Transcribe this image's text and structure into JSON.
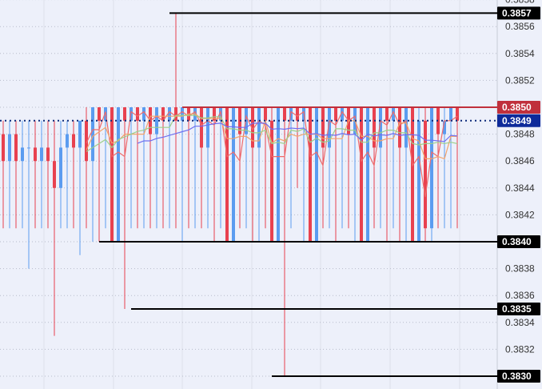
{
  "chart_data": {
    "type": "candlestick",
    "title": "",
    "ylim": [
      0.38295,
      0.38582
    ],
    "y_ticks": [
      "0.3858",
      "0.3856",
      "0.3854",
      "0.3852",
      "0.3850",
      "0.3848",
      "0.3846",
      "0.3844",
      "0.3842",
      "0.3840",
      "0.3838",
      "0.3836",
      "0.3834",
      "0.3832",
      "0.3830"
    ],
    "colors": {
      "up": "#5b9cf0",
      "down": "#e8414f",
      "background": "#edf0fa",
      "grid": "#b8bccb"
    },
    "moving_averages": [
      {
        "period": 3,
        "color": "#ef6a6a"
      },
      {
        "period": 6,
        "color": "#f2a36a"
      },
      {
        "period": 10,
        "color": "#9ccf8a"
      },
      {
        "period": 22,
        "color": "#6f6ff0"
      }
    ],
    "candles": [
      [
        0.3848,
        0.3849,
        0.3841,
        0.3846
      ],
      [
        0.3846,
        0.3849,
        0.3841,
        0.3848
      ],
      [
        0.3848,
        0.3849,
        0.3841,
        0.3846
      ],
      [
        0.3846,
        0.3849,
        0.3841,
        0.3847
      ],
      [
        0.3847,
        0.3849,
        0.3838,
        0.3847
      ],
      [
        0.3847,
        0.3849,
        0.3841,
        0.3846
      ],
      [
        0.3846,
        0.3849,
        0.3841,
        0.3847
      ],
      [
        0.3847,
        0.3849,
        0.3841,
        0.3846
      ],
      [
        0.3846,
        0.3849,
        0.3833,
        0.3844
      ],
      [
        0.3844,
        0.3849,
        0.3841,
        0.3847
      ],
      [
        0.3847,
        0.3849,
        0.3841,
        0.3848
      ],
      [
        0.3848,
        0.3849,
        0.3841,
        0.3847
      ],
      [
        0.3847,
        0.3849,
        0.3839,
        0.3849
      ],
      [
        0.3849,
        0.385,
        0.3841,
        0.3846
      ],
      [
        0.3846,
        0.385,
        0.384,
        0.385
      ],
      [
        0.385,
        0.385,
        0.384,
        0.3849
      ],
      [
        0.3849,
        0.385,
        0.3841,
        0.385
      ],
      [
        0.385,
        0.385,
        0.384,
        0.384
      ],
      [
        0.384,
        0.385,
        0.384,
        0.385
      ],
      [
        0.385,
        0.385,
        0.3835,
        0.3849
      ],
      [
        0.3849,
        0.385,
        0.3841,
        0.385
      ],
      [
        0.385,
        0.385,
        0.3841,
        0.3849
      ],
      [
        0.3849,
        0.385,
        0.3841,
        0.385
      ],
      [
        0.385,
        0.385,
        0.3841,
        0.3848
      ],
      [
        0.3848,
        0.385,
        0.3841,
        0.385
      ],
      [
        0.385,
        0.385,
        0.3841,
        0.3849
      ],
      [
        0.3849,
        0.385,
        0.3841,
        0.385
      ],
      [
        0.385,
        0.3857,
        0.3841,
        0.3849
      ],
      [
        0.3849,
        0.385,
        0.384,
        0.385
      ],
      [
        0.385,
        0.385,
        0.3841,
        0.3849
      ],
      [
        0.3849,
        0.385,
        0.3841,
        0.385
      ],
      [
        0.385,
        0.385,
        0.3841,
        0.3847
      ],
      [
        0.3847,
        0.385,
        0.3841,
        0.385
      ],
      [
        0.385,
        0.385,
        0.384,
        0.3849
      ],
      [
        0.3849,
        0.385,
        0.3841,
        0.385
      ],
      [
        0.385,
        0.385,
        0.384,
        0.384
      ],
      [
        0.384,
        0.385,
        0.384,
        0.385
      ],
      [
        0.385,
        0.385,
        0.3841,
        0.3848
      ],
      [
        0.3848,
        0.385,
        0.3841,
        0.385
      ],
      [
        0.385,
        0.385,
        0.384,
        0.3847
      ],
      [
        0.3847,
        0.385,
        0.384,
        0.385
      ],
      [
        0.385,
        0.385,
        0.3841,
        0.3849
      ],
      [
        0.3849,
        0.385,
        0.384,
        0.384
      ],
      [
        0.384,
        0.385,
        0.384,
        0.385
      ],
      [
        0.385,
        0.385,
        0.383,
        0.3849
      ],
      [
        0.3849,
        0.385,
        0.3841,
        0.385
      ],
      [
        0.385,
        0.385,
        0.3844,
        0.3849
      ],
      [
        0.3849,
        0.385,
        0.384,
        0.385
      ],
      [
        0.385,
        0.385,
        0.384,
        0.384
      ],
      [
        0.384,
        0.385,
        0.384,
        0.385
      ],
      [
        0.385,
        0.385,
        0.3841,
        0.3847
      ],
      [
        0.3847,
        0.385,
        0.3841,
        0.385
      ],
      [
        0.385,
        0.385,
        0.384,
        0.3849
      ],
      [
        0.3849,
        0.385,
        0.3841,
        0.385
      ],
      [
        0.385,
        0.385,
        0.3841,
        0.3848
      ],
      [
        0.3848,
        0.385,
        0.384,
        0.385
      ],
      [
        0.385,
        0.385,
        0.384,
        0.384
      ],
      [
        0.384,
        0.385,
        0.384,
        0.385
      ],
      [
        0.385,
        0.385,
        0.3841,
        0.3847
      ],
      [
        0.3847,
        0.385,
        0.3841,
        0.385
      ],
      [
        0.385,
        0.385,
        0.384,
        0.3849
      ],
      [
        0.3849,
        0.385,
        0.3841,
        0.385
      ],
      [
        0.385,
        0.385,
        0.384,
        0.3847
      ],
      [
        0.3847,
        0.385,
        0.384,
        0.385
      ],
      [
        0.385,
        0.385,
        0.384,
        0.384
      ],
      [
        0.384,
        0.385,
        0.384,
        0.3849
      ],
      [
        0.3849,
        0.385,
        0.384,
        0.3841
      ],
      [
        0.3841,
        0.385,
        0.384,
        0.385
      ],
      [
        0.385,
        0.385,
        0.3841,
        0.3848
      ],
      [
        0.3848,
        0.385,
        0.3841,
        0.3849
      ],
      [
        0.3849,
        0.385,
        0.3841,
        0.385
      ],
      [
        0.385,
        0.385,
        0.3841,
        0.3849
      ]
    ],
    "price_lines": [
      {
        "label": "0.3857",
        "price": 0.3857,
        "style": "solid",
        "color": "#000000",
        "start_candle": 27
      },
      {
        "label": "0.3850",
        "price": 0.385,
        "style": "solid",
        "color": "#c0303c",
        "start_candle": 29
      },
      {
        "label": "0.3849",
        "price": 0.3849,
        "style": "dotted",
        "color": "#0d2a7a",
        "start_candle": 0
      },
      {
        "label": "0.3840",
        "price": 0.384,
        "style": "solid",
        "color": "#000000",
        "start_candle": 16
      },
      {
        "label": "0.3835",
        "price": 0.3835,
        "style": "solid",
        "color": "#000000",
        "start_candle": 21
      },
      {
        "label": "0.3830",
        "price": 0.383,
        "style": "solid",
        "color": "#000000",
        "start_candle": 43
      }
    ],
    "badge_colors": {
      "0.3857": "#000000",
      "0.3850": "#c0303c",
      "0.3849": "#0d2a9a",
      "0.3840": "#000000",
      "0.3835": "#000000",
      "0.3830": "#000000"
    }
  }
}
